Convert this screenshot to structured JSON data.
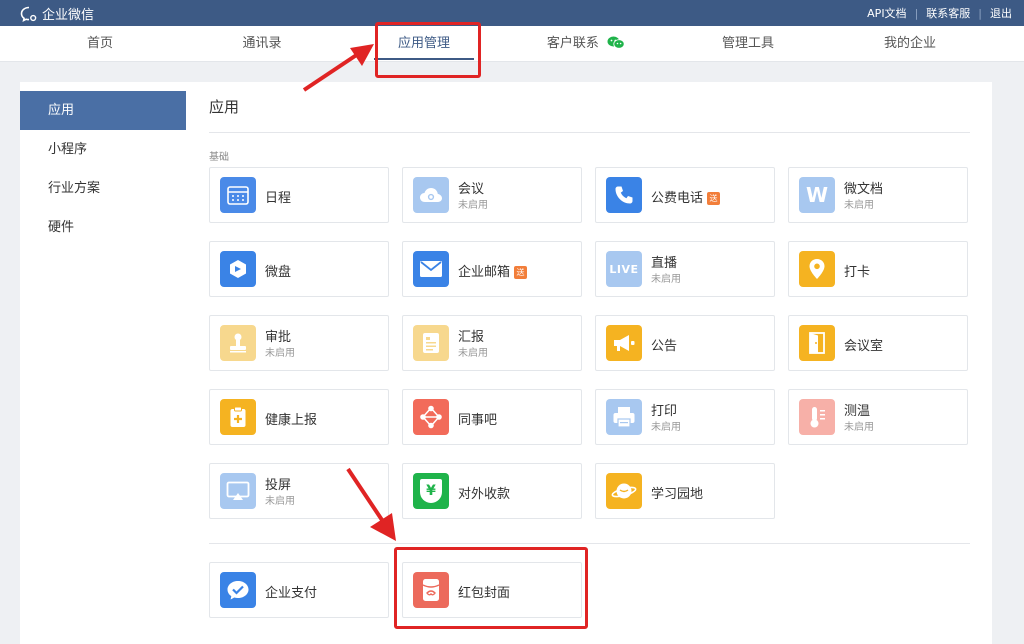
{
  "topbar": {
    "brand": "企业微信",
    "links": [
      "API文档",
      "联系客服",
      "退出"
    ]
  },
  "nav": {
    "tabs": [
      {
        "label": "首页"
      },
      {
        "label": "通讯录"
      },
      {
        "label": "应用管理",
        "active": true
      },
      {
        "label": "客户联系"
      },
      {
        "label": "管理工具"
      },
      {
        "label": "我的企业"
      }
    ]
  },
  "sidebar": {
    "items": [
      {
        "label": "应用",
        "active": true
      },
      {
        "label": "小程序"
      },
      {
        "label": "行业方案"
      },
      {
        "label": "硬件"
      }
    ]
  },
  "content": {
    "title": "应用",
    "section_label": "基础"
  },
  "apps": [
    {
      "name": "日程",
      "icon": "calendar-icon",
      "color": "#4a8ae8"
    },
    {
      "name": "会议",
      "status": "未启用",
      "icon": "cloud-icon",
      "color": "#a8c8f0"
    },
    {
      "name": "公费电话",
      "badge": "送",
      "icon": "phone-icon",
      "color": "#3a83e6"
    },
    {
      "name": "微文档",
      "status": "未启用",
      "icon": "document-w-icon",
      "color": "#a8c8f0"
    },
    {
      "name": "微盘",
      "icon": "drive-icon",
      "color": "#3a83e6"
    },
    {
      "name": "企业邮箱",
      "badge": "送",
      "icon": "mail-icon",
      "color": "#3a83e6"
    },
    {
      "name": "直播",
      "status": "未启用",
      "icon": "live-icon",
      "icon_text": "LIVE",
      "color": "#a8c8f0"
    },
    {
      "name": "打卡",
      "icon": "location-pin-icon",
      "color": "#f5b321"
    },
    {
      "name": "审批",
      "status": "未启用",
      "icon": "stamp-icon",
      "color": "#f7d88e"
    },
    {
      "name": "汇报",
      "status": "未启用",
      "icon": "report-icon",
      "color": "#f7d88e"
    },
    {
      "name": "公告",
      "icon": "megaphone-icon",
      "color": "#f5b321"
    },
    {
      "name": "会议室",
      "icon": "door-icon",
      "color": "#f5b321"
    },
    {
      "name": "健康上报",
      "icon": "health-icon",
      "color": "#f5b321"
    },
    {
      "name": "同事吧",
      "icon": "network-icon",
      "color": "#f26b5a"
    },
    {
      "name": "打印",
      "status": "未启用",
      "icon": "printer-icon",
      "color": "#a8c8f0"
    },
    {
      "name": "测温",
      "status": "未启用",
      "icon": "thermometer-icon",
      "color": "#f7b0a8"
    },
    {
      "name": "投屏",
      "status": "未启用",
      "icon": "screen-cast-icon",
      "color": "#a8c8f0"
    },
    {
      "name": "对外收款",
      "icon": "payment-icon",
      "icon_text": "¥",
      "color": "#1fb34a"
    },
    {
      "name": "学习园地",
      "icon": "planet-icon",
      "color": "#f5b321"
    }
  ],
  "extra_apps": [
    {
      "name": "企业支付",
      "icon": "pay-check-icon",
      "color": "#3a83e6"
    },
    {
      "name": "红包封面",
      "icon": "red-packet-icon",
      "color": "#ec6a5c"
    }
  ],
  "annotation_color": "#e02424"
}
